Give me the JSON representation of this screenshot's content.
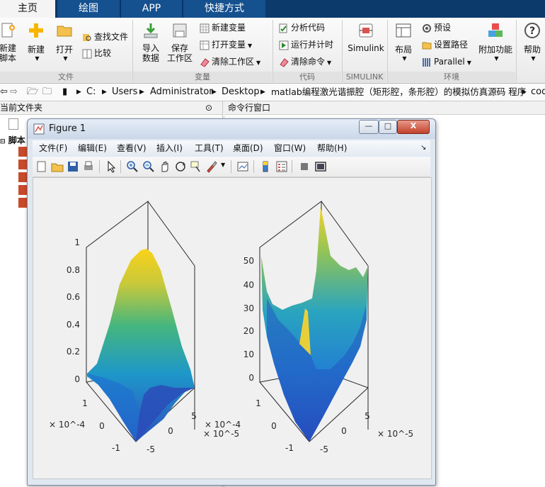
{
  "tabs": [
    {
      "label": "主页",
      "active": true
    },
    {
      "label": "绘图",
      "active": false
    },
    {
      "label": "APP",
      "active": false
    },
    {
      "label": "快捷方式",
      "active": false
    }
  ],
  "ribbon": {
    "file_group": {
      "label": "文件",
      "new_script": "新建\n脚本",
      "new": "新建",
      "open": "打开",
      "find_files": "查找文件",
      "compare": "比较"
    },
    "variable_group": {
      "label": "变量",
      "import": "导入\n数据",
      "save_workspace": "保存\n工作区",
      "new_variable": "新建变量",
      "open_variable": "打开变量",
      "clear_workspace": "清除工作区"
    },
    "code_group": {
      "label": "代码",
      "analyze": "分析代码",
      "run_time": "运行并计时",
      "clear_commands": "清除命令"
    },
    "simulink_group": {
      "label": "SIMULINK",
      "simulink": "Simulink"
    },
    "env_group": {
      "label": "环境",
      "layout": "布局",
      "preferences": "预设",
      "set_path": "设置路径",
      "parallel": "Parallel",
      "addons": "附加功能",
      "help": "帮助"
    }
  },
  "address": {
    "crumbs": [
      "C:",
      "Users",
      "Administrator",
      "Desktop",
      "matlab编程激光谐振腔（矩形腔，条形腔）的模拟仿真源码 程序",
      "cod"
    ]
  },
  "left_panel": {
    "title": "当前文件夹",
    "section": "脚本"
  },
  "right_panel": {
    "title": "命令行窗口"
  },
  "figure": {
    "title": "Figure 1",
    "menu": [
      "文件(F)",
      "编辑(E)",
      "查看(V)",
      "插入(I)",
      "工具(T)",
      "桌面(D)",
      "窗口(W)",
      "帮助(H)"
    ],
    "window_buttons": {
      "minimize": "—",
      "maximize": "□",
      "close": "X"
    }
  },
  "chart_data": [
    {
      "type": "surface",
      "title": "",
      "z_ticks": [
        "0",
        "0.2",
        "0.4",
        "0.6",
        "0.8",
        "1"
      ],
      "x_ticks": [
        "-1",
        "0",
        "1"
      ],
      "x_multiplier": "× 10^-4",
      "y_ticks": [
        "-5",
        "0",
        "5"
      ],
      "y_multiplier": "× 10^-5",
      "zlim": [
        0,
        1
      ],
      "description": "Gaussian-like peak centered near (0,0) with maximum ≈ 1"
    },
    {
      "type": "surface",
      "title": "",
      "z_ticks": [
        "0",
        "10",
        "20",
        "30",
        "40",
        "50"
      ],
      "x_ticks": [
        "-1",
        "0",
        "1"
      ],
      "x_multiplier": "× 10^-4",
      "y_ticks": [
        "-5",
        "0",
        "5"
      ],
      "y_multiplier": "× 10^-5",
      "zlim": [
        0,
        50
      ],
      "description": "Bowl-shaped surface with central spike ~ 30 and edge peak ~ 55"
    }
  ],
  "colors": {
    "tab_bar": "#0b3a6b",
    "surface_low": "#3b4cc0",
    "surface_high": "#f9d21a"
  }
}
